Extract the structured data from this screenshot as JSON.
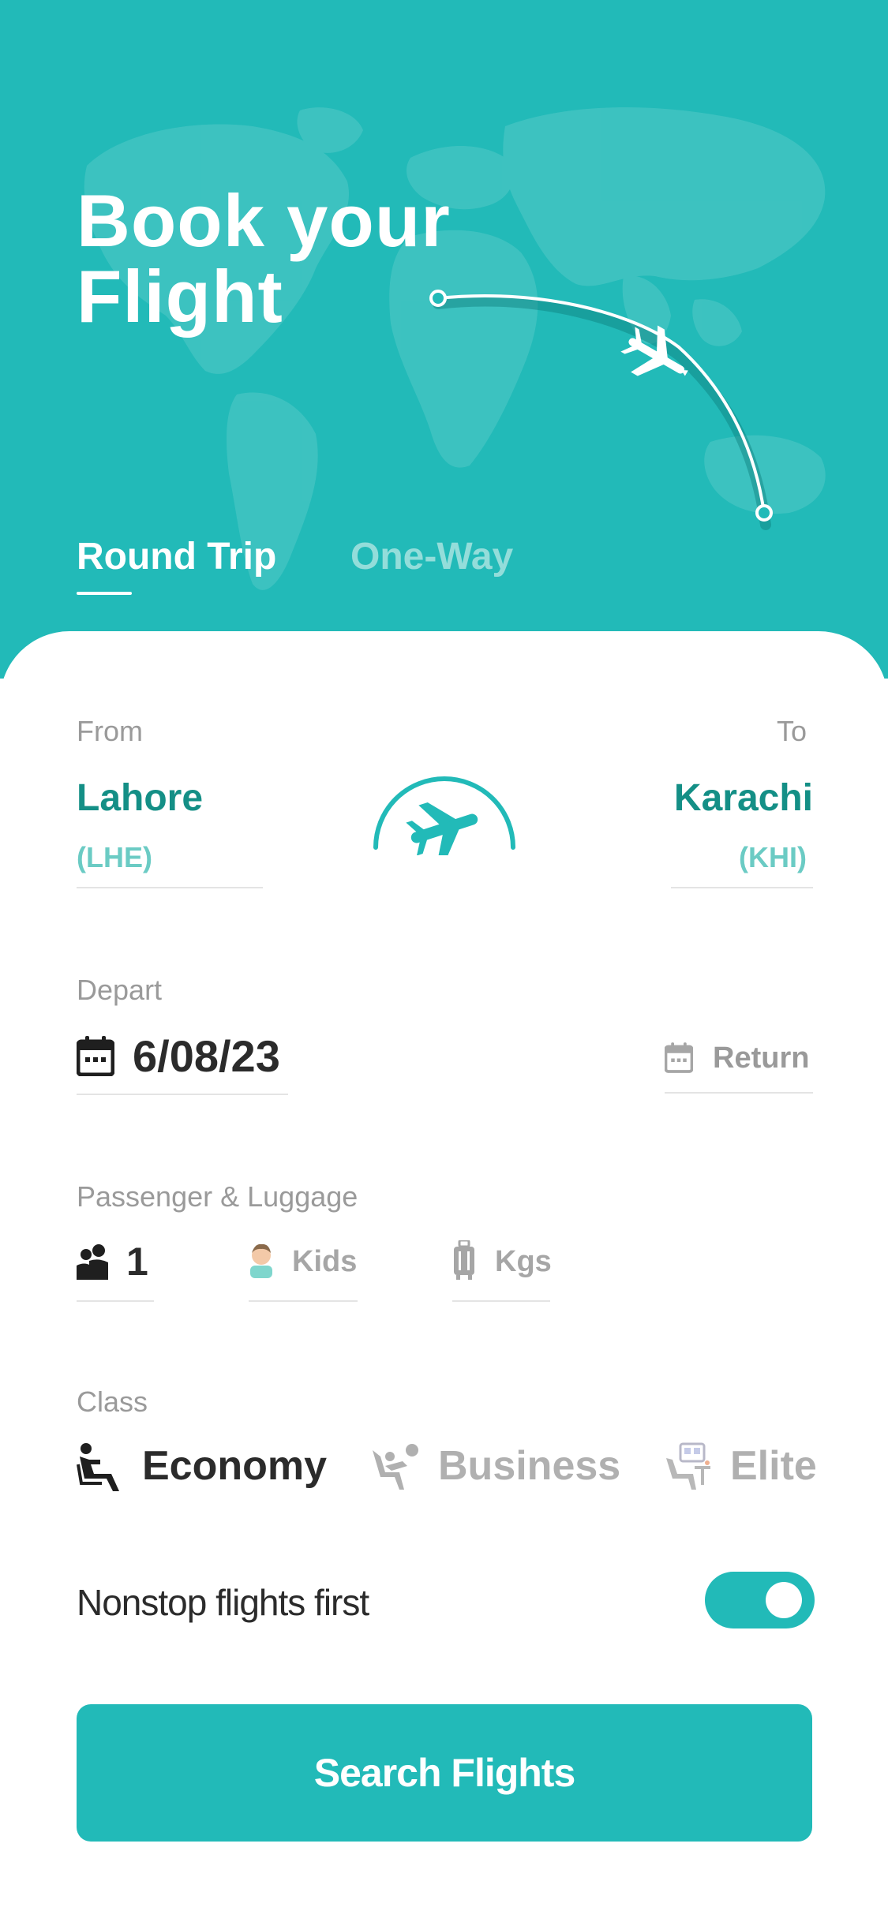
{
  "header": {
    "title_line1": "Book  your",
    "title_line2": "Flight"
  },
  "tabs": [
    {
      "label": "Round Trip",
      "active": true
    },
    {
      "label": "One-Way",
      "active": false
    }
  ],
  "route": {
    "from_label": "From",
    "to_label": "To",
    "from_city": "Lahore",
    "from_code": "(LHE)",
    "to_city": "Karachi",
    "to_code": "(KHI)"
  },
  "dates": {
    "depart_label": "Depart",
    "depart_value": "6/08/23",
    "return_label": "Return"
  },
  "passenger": {
    "label": "Passenger & Luggage",
    "adults": "1",
    "kids_label": "Kids",
    "kgs_label": "Kgs"
  },
  "class": {
    "label": "Class",
    "options": [
      "Economy",
      "Business",
      "Elite"
    ],
    "selected": "Economy"
  },
  "nonstop": {
    "label": "Nonstop flights first",
    "enabled": true
  },
  "search_button": "Search Flights",
  "colors": {
    "primary": "#22BAB8",
    "city_text": "#148F86",
    "code_text": "#6BCBC4",
    "inactive_tab": "#93DDDA"
  },
  "icons": {
    "depart": "calendar-icon",
    "return": "calendar-icon",
    "adults": "people-icon",
    "kids": "child-avatar-icon",
    "luggage": "luggage-icon",
    "economy": "economy-seat-icon",
    "business": "business-seat-icon",
    "elite": "elite-seat-icon",
    "swap": "airplane-icon"
  }
}
